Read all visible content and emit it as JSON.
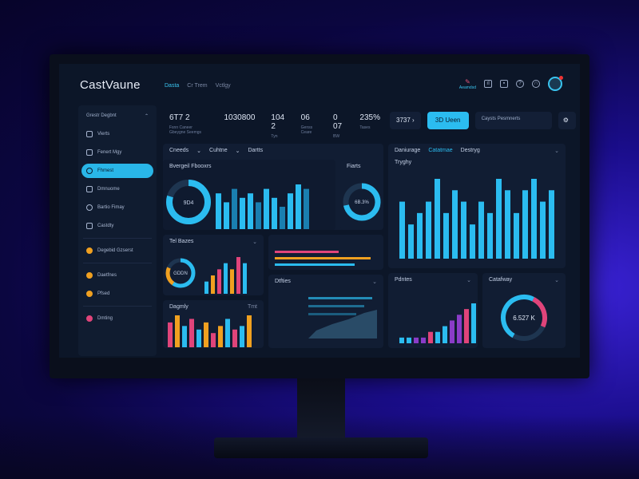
{
  "app": {
    "title": "CastVaune"
  },
  "topnav": [
    "Dasta",
    "Cr Trem",
    "Vctlgy"
  ],
  "toolbar": {
    "alert_label": "Aeamdsd"
  },
  "sidebar": {
    "header": "Grestr Degbnt",
    "items": [
      {
        "label": "Vierts",
        "icon": "chart-icon"
      },
      {
        "label": "Fenert Mgy",
        "icon": "doc-icon"
      },
      {
        "label": "Fhmest",
        "icon": "info-icon",
        "active": true
      },
      {
        "label": "Dmnuome",
        "icon": "link-icon"
      },
      {
        "label": "Bartio Fimay",
        "icon": "gear-icon"
      },
      {
        "label": "Castdty",
        "icon": "folder-icon"
      },
      {
        "label": "Degebid Gzserst",
        "icon": "user-icon"
      },
      {
        "label": "Daetfnes",
        "icon": "star-icon"
      },
      {
        "label": "Pfsed",
        "icon": "flag-icon"
      },
      {
        "label": "Dmting",
        "icon": "user-icon"
      }
    ]
  },
  "stats": [
    {
      "value": "6T7 2",
      "label": "Fsnn Caneer Gbeygne Seemgs"
    },
    {
      "value": "1030800",
      "label": ""
    },
    {
      "value": "104 2",
      "label": "Tyn"
    },
    {
      "value": "06",
      "label": "Genss Ceare"
    },
    {
      "value": "0 07",
      "label": "BW"
    },
    {
      "value": "235%",
      "label": "Tases"
    }
  ],
  "actions": {
    "pill1": "3737",
    "primary": "3D Ueen",
    "pill2": "Caysts Pesmnerts"
  },
  "cards": {
    "c1": {
      "tabs": [
        "Cneeds",
        "Cuhtne",
        "Dartts"
      ],
      "subtitle": "Bvergeil Fbooxrs",
      "donut": "9D4"
    },
    "c2": {
      "title": "Fiarts",
      "donut": "6B.3%"
    },
    "c3": {
      "tabs": [
        "Daniurage",
        "Catatmae",
        "Destryg"
      ],
      "subtitle": "Tryghy"
    },
    "c4": {
      "title": "Tel Bazes",
      "donut": "GDDN"
    },
    "c5": {
      "title": "Dagmly",
      "tag": "Tmt"
    },
    "c6": {
      "title": "Dtfties"
    },
    "c7": {
      "title": "Pdntes"
    },
    "c8": {
      "title": "Catafway",
      "donut": "6.527 K"
    }
  },
  "chart_data": [
    {
      "type": "bar",
      "title": "Bvergeil Fbooxrs",
      "values": [
        8,
        6,
        9,
        7,
        8,
        6,
        9,
        7,
        5,
        8,
        10,
        9
      ]
    },
    {
      "type": "bar",
      "title": "Tryghy",
      "values": [
        5,
        3,
        4,
        5,
        7,
        4,
        6,
        5,
        3,
        5,
        4,
        7,
        6,
        4,
        6,
        7,
        5,
        6
      ]
    },
    {
      "type": "bar",
      "title": "Tel Bazes",
      "values": [
        2,
        3,
        4,
        5,
        4,
        6,
        5
      ]
    },
    {
      "type": "bar",
      "title": "Dagmly",
      "values": [
        7,
        9,
        6,
        8,
        5,
        7,
        4,
        6,
        8,
        5,
        6,
        9
      ]
    },
    {
      "type": "bar",
      "title": "Pdntes",
      "values": [
        1,
        1,
        1,
        1,
        2,
        2,
        3,
        4,
        5,
        6,
        7
      ]
    }
  ],
  "colors": {
    "accent": "#2bbcf0",
    "orange": "#f0a020",
    "pink": "#e0447a",
    "purple": "#8a3cc8"
  }
}
